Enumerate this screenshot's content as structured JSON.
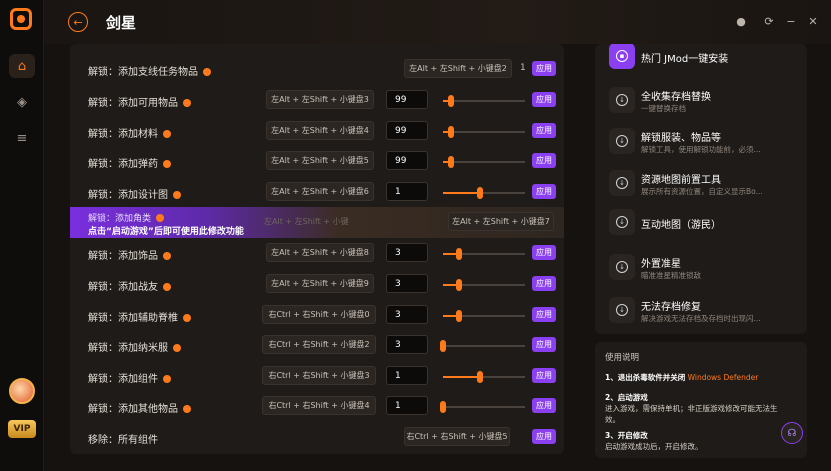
{
  "header": {
    "title": "剑星",
    "back_icon": "←"
  },
  "rows": [
    {
      "label": "解锁：添加支线任务物品",
      "key": "左Alt + 左Shift + 小键盘2",
      "count": "1",
      "slider": null,
      "value": null,
      "apply": "应用"
    },
    {
      "label": "解锁：添加可用物品",
      "key": "左Alt + 左Shift + 小键盘3",
      "value": "99",
      "slider": 0.1,
      "apply": "应用"
    },
    {
      "label": "解锁：添加材料",
      "key": "左Alt + 左Shift + 小键盘4",
      "value": "99",
      "slider": 0.1,
      "apply": "应用"
    },
    {
      "label": "解锁：添加弹药",
      "key": "左Alt + 左Shift + 小键盘5",
      "value": "99",
      "slider": 0.1,
      "apply": "应用"
    },
    {
      "label": "解锁：添加设计图",
      "key": "左Alt + 左Shift + 小键盘6",
      "value": "1",
      "slider": 0.45,
      "apply": "应用"
    },
    {
      "label": "解锁：添加饰品",
      "key": "左Alt + 左Shift + 小键盘8",
      "value": "3",
      "slider": 0.2,
      "apply": "应用"
    },
    {
      "label": "解锁：添加战友",
      "key": "左Alt + 左Shift + 小键盘9",
      "value": "3",
      "slider": 0.2,
      "apply": "应用"
    },
    {
      "label": "解锁：添加辅助脊椎",
      "key": "右Ctrl + 右Shift + 小键盘0",
      "value": "3",
      "slider": 0.2,
      "apply": "应用"
    },
    {
      "label": "解锁：添加纳米服",
      "key": "右Ctrl + 右Shift + 小键盘2",
      "value": "3",
      "slider": 0.0,
      "apply": "应用"
    },
    {
      "label": "解锁：添加组件",
      "key": "右Ctrl + 右Shift + 小键盘3",
      "value": "1",
      "slider": 0.45,
      "apply": "应用"
    },
    {
      "label": "解锁：添加其他物品",
      "key": "右Ctrl + 右Shift + 小键盘4",
      "value": "1",
      "slider": 0.0,
      "apply": "应用"
    },
    {
      "label": "移除：所有组件",
      "key": "右Ctrl + 右Shift + 小键盘5",
      "value": null,
      "slider": null,
      "apply": "应用"
    }
  ],
  "notice": {
    "label": "解锁：添加角类",
    "warning": "点击“启动游戏”后即可使用此修改功能",
    "ghost": "左Alt + 左Shift + 小键",
    "key": "左Alt + 左Shift + 小键盘7"
  },
  "right_list": [
    {
      "title": "热门 JMod一键安装",
      "sub": ""
    },
    {
      "title": "全收集存档替换",
      "sub": "一键替换存档"
    },
    {
      "title": "解锁服装、物品等",
      "sub": "解锁工具，使用解锁功能前，必须..."
    },
    {
      "title": "资源地图前置工具",
      "sub": "展示所有资源位置，自定义显示Bo..."
    },
    {
      "title": "互动地图（游民）",
      "sub": ""
    },
    {
      "title": "外置准星",
      "sub": "瞄准准星精准锁敌"
    },
    {
      "title": "无法存档修复",
      "sub": "解决游戏无法存档及存档时出现闪..."
    }
  ],
  "usage": {
    "title": "使用说明",
    "step1_title": "1、退出杀毒软件并关闭",
    "step1_link": "Windows Defender",
    "step2_title": "2、启动游戏",
    "step2_body": "进入游戏，需保持单机；非正版游戏修改可能无法生效。",
    "step3_title": "3、开启修改",
    "step3_body": "启动游戏成功后，开启修改。"
  },
  "colors": {
    "accent": "#ff7a1a",
    "apply": "#8a3ff0"
  }
}
